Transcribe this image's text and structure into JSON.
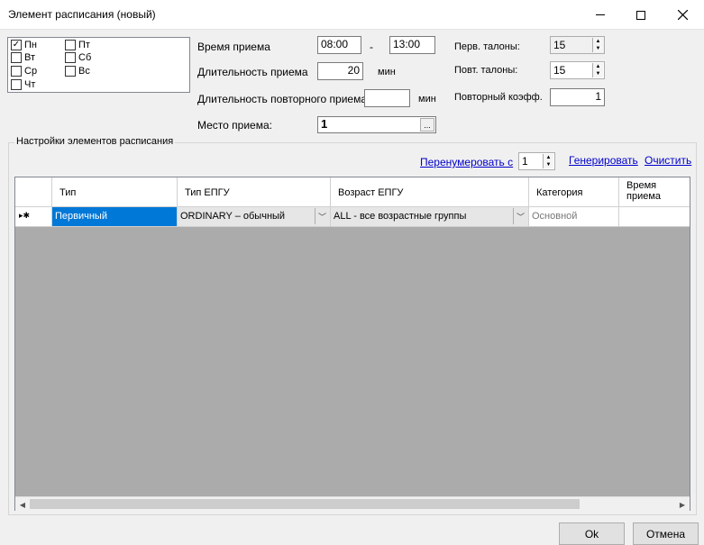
{
  "window": {
    "title": "Элемент расписания (новый)",
    "minimize_icon": "minimize-icon",
    "maximize_icon": "maximize-icon",
    "close_icon": "close-icon"
  },
  "days": [
    {
      "label": "Пн",
      "checked": true
    },
    {
      "label": "Вт",
      "checked": false
    },
    {
      "label": "Ср",
      "checked": false
    },
    {
      "label": "Чт",
      "checked": false
    },
    {
      "label": "Пт",
      "checked": false
    },
    {
      "label": "Сб",
      "checked": false
    },
    {
      "label": "Вс",
      "checked": false
    }
  ],
  "fields": {
    "time_label": "Время приема",
    "time_from": "08:00",
    "time_dash": "-",
    "time_to": "13:00",
    "duration_label": "Длительность приема",
    "duration_value": "20",
    "duration_unit": "мин",
    "repeat_duration_label": "Длительность повторного приема",
    "repeat_duration_value": "",
    "repeat_duration_unit": "мин",
    "place_label": "Место приема:",
    "place_value": "1",
    "place_browse": "...",
    "first_tickets_label": "Перв. талоны:",
    "first_tickets_value": "15",
    "repeat_tickets_label": "Повт. талоны:",
    "repeat_tickets_value": "15",
    "repeat_coef_label": "Повторный коэфф.",
    "repeat_coef_value": "1"
  },
  "settings": {
    "group_title": "Настройки элементов расписания",
    "renumber_link": "Перенумеровать с",
    "renumber_value": "1",
    "generate_link": "Генерировать",
    "clear_link": "Очистить"
  },
  "table": {
    "columns": [
      "Тип",
      "Тип ЕПГУ",
      "Возраст ЕПГУ",
      "Категория",
      "Время приема"
    ],
    "row_indicator": "▸✱",
    "rows": [
      {
        "type": "Первичный",
        "epgu_type": "ORDINARY – обычный",
        "epgu_age": "ALL - все возрастные группы",
        "category": "Основной",
        "time": ""
      }
    ]
  },
  "buttons": {
    "ok": "Ok",
    "cancel": "Отмена"
  },
  "colors": {
    "selection": "#0078d7",
    "link": "#0000cc",
    "grid_background": "#ababab"
  }
}
